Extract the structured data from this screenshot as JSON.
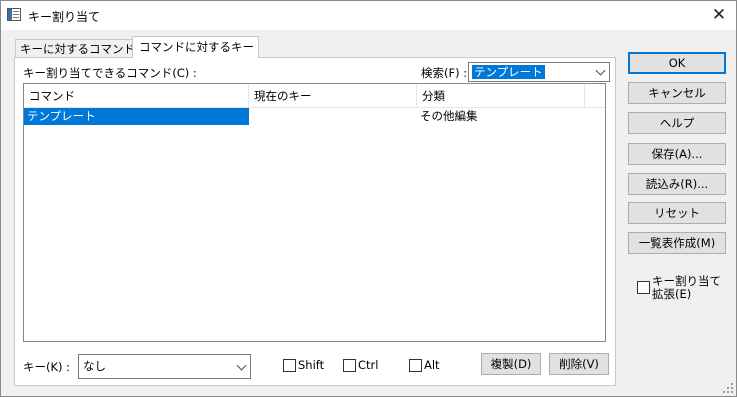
{
  "window": {
    "title": "キー割り当て",
    "close_glyph": "✕"
  },
  "tabs": [
    {
      "label": "キーに対するコマンド",
      "active": false
    },
    {
      "label": "コマンドに対するキー",
      "active": true
    }
  ],
  "panel": {
    "commands_label": "キー割り当てできるコマンド(C) :",
    "search_label": "検索(F) :",
    "search_value": "テンプレート",
    "columns": [
      "コマンド",
      "現在のキー",
      "分類"
    ],
    "rows": [
      {
        "command": "テンプレート",
        "key": "",
        "category": "その他編集",
        "selected": true
      }
    ],
    "key_label": "キー(K) :",
    "key_value": "なし",
    "modifiers": {
      "shift": "Shift",
      "ctrl": "Ctrl",
      "alt": "Alt"
    },
    "copy_button": "複製(D)",
    "delete_button": "削除(V)"
  },
  "side_buttons": {
    "ok": "OK",
    "cancel": "キャンセル",
    "help": "ヘルプ",
    "save": "保存(A)...",
    "load": "読込み(R)...",
    "reset": "リセット",
    "list": "一覧表作成(M)"
  },
  "extend": {
    "line1": "キー割り当て",
    "line2": "拡張(E)"
  }
}
